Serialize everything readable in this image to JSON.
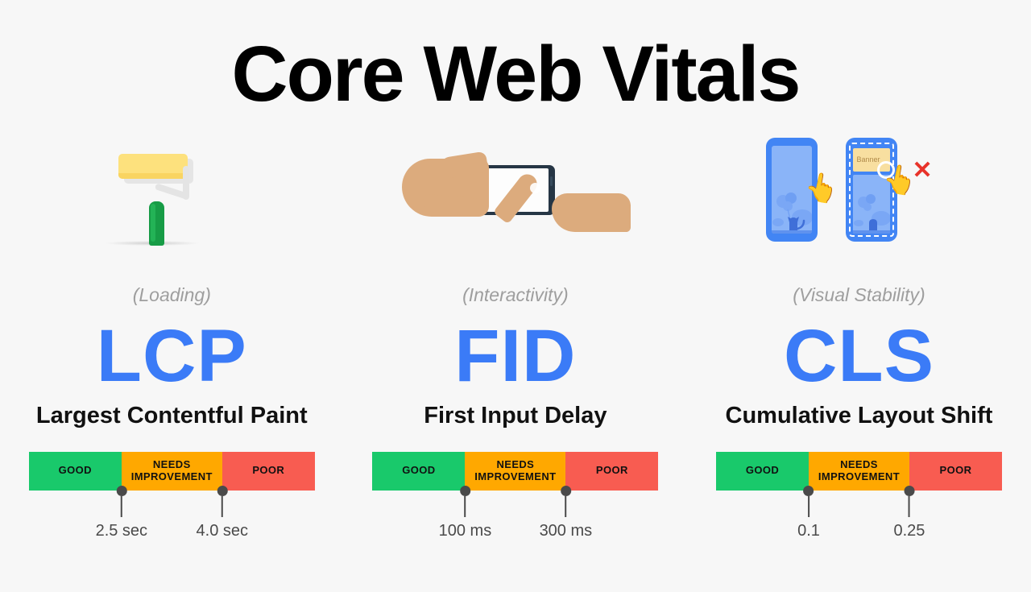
{
  "page": {
    "title": "Core Web Vitals",
    "background_color": "#f7f7f7",
    "accent_color": "#3b7bf7"
  },
  "legend": {
    "good_label": "GOOD",
    "needs_improvement_label": "NEEDS\nIMPROVEMENT",
    "needs_improvement_line1": "NEEDS",
    "needs_improvement_line2": "IMPROVEMENT",
    "poor_label": "POOR",
    "good_color": "#19c96b",
    "needs_improvement_color": "#ffa800",
    "poor_color": "#f85c51"
  },
  "metrics": [
    {
      "acronym": "LCP",
      "name": "Largest Contentful Paint",
      "aspect": "(Loading)",
      "icon": "paint-roller-icon",
      "thresholds": [
        {
          "label": "2.5 sec",
          "position_pct": 32.4
        },
        {
          "label": "4.0 sec",
          "position_pct": 67.6
        }
      ]
    },
    {
      "acronym": "FID",
      "name": "First Input Delay",
      "aspect": "(Interactivity)",
      "icon": "hands-tapping-phone-icon",
      "thresholds": [
        {
          "label": "100 ms",
          "position_pct": 32.4
        },
        {
          "label": "300 ms",
          "position_pct": 67.6
        }
      ]
    },
    {
      "acronym": "CLS",
      "name": "Cumulative Layout Shift",
      "aspect": "(Visual Stability)",
      "icon": "shifting-banner-phones-icon",
      "thresholds": [
        {
          "label": "0.1",
          "position_pct": 32.4
        },
        {
          "label": "0.25",
          "position_pct": 67.6
        }
      ]
    }
  ],
  "cls_illustration": {
    "banner_text": "Banner",
    "pointer_glyph": "👆",
    "error_glyph": "✕"
  }
}
